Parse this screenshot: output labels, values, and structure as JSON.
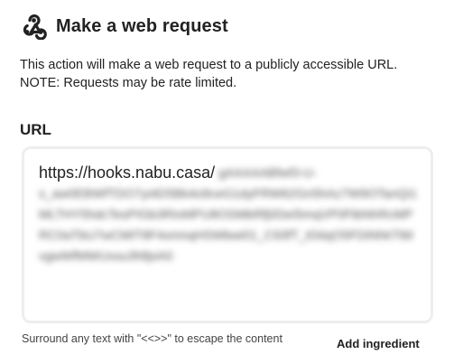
{
  "header": {
    "icon": "webhooks-icon",
    "title": "Make a web request"
  },
  "description": {
    "line1": "This action will make a web request to a publicly accessible URL.",
    "line2": "NOTE: Requests may be rate limited."
  },
  "url_field": {
    "label": "URL",
    "value_visible": "https://hooks.nabu.casa/",
    "value_redacted_inline": "gAAAAABfwf3-U-",
    "value_redacted_rest": "s_aw0EBWfTDO7yi4D5Bk4o9ceG1dyFRW62Gn5hAz7W9OTanQi1MLTHY5hdcTesPIGb3RIxMPU8OSMbRfj0DeI5mqVP0FtbNhRcMPRC0aTbU7wCMIT8F4xmnqHSWbwi01_C93fT_tGtiqO5FDiNhkTtMvgwWfMWUxsu3NfpiA0",
    "helper_text": "Surround any text with \"<<>>\" to escape the content"
  },
  "actions": {
    "add_ingredient": "Add ingredient"
  }
}
